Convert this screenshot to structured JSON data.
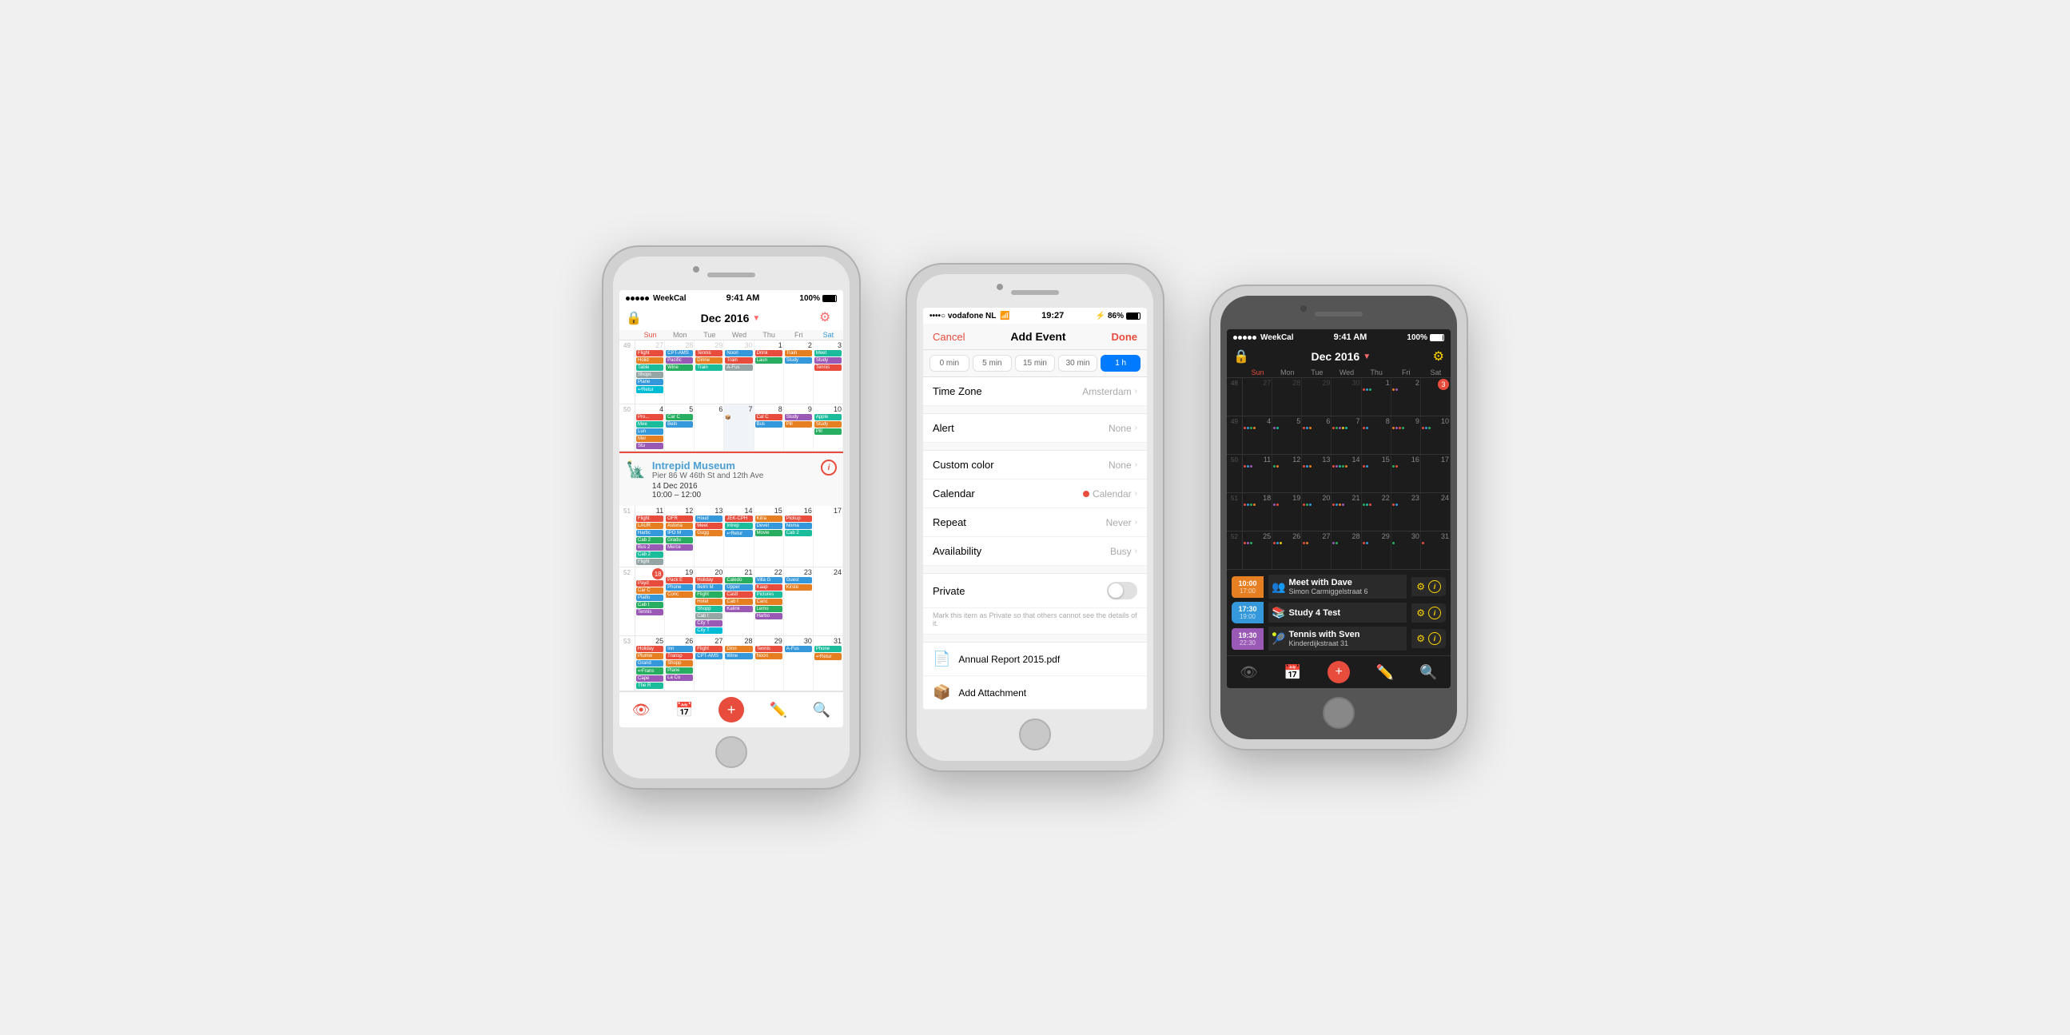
{
  "phone1": {
    "statusBar": {
      "carrier": "WeekCal",
      "time": "9:41 AM",
      "battery": "100%"
    },
    "header": {
      "title": "Dec 2016",
      "gearIcon": "⚙"
    },
    "dayLabels": [
      "",
      "Sun",
      "Mon",
      "Tue",
      "Wed",
      "Thu",
      "Fri",
      "Sat"
    ],
    "weeks": [
      {
        "weekNum": "49",
        "days": [
          {
            "date": "27",
            "prev": true
          },
          {
            "date": "28",
            "prev": true
          },
          {
            "date": "29",
            "prev": true
          },
          {
            "date": "30",
            "prev": true
          },
          {
            "date": "1"
          },
          {
            "date": "2"
          },
          {
            "date": "3"
          }
        ]
      },
      {
        "weekNum": "50",
        "days": [
          {
            "date": "4"
          },
          {
            "date": "5"
          },
          {
            "date": "6"
          },
          {
            "date": "7"
          },
          {
            "date": "8"
          },
          {
            "date": "9"
          },
          {
            "date": "10"
          }
        ]
      },
      {
        "weekNum": "51",
        "days": [
          {
            "date": "11"
          },
          {
            "date": "12"
          },
          {
            "date": "13"
          },
          {
            "date": "14"
          },
          {
            "date": "15"
          },
          {
            "date": "16"
          },
          {
            "date": "17"
          }
        ]
      },
      {
        "weekNum": "52",
        "days": [
          {
            "date": "18"
          },
          {
            "date": "19"
          },
          {
            "date": "20"
          },
          {
            "date": "21"
          },
          {
            "date": "22"
          },
          {
            "date": "23"
          },
          {
            "date": "24"
          }
        ]
      },
      {
        "weekNum": "53",
        "days": [
          {
            "date": "25"
          },
          {
            "date": "26"
          },
          {
            "date": "27"
          },
          {
            "date": "28"
          },
          {
            "date": "29"
          },
          {
            "date": "30"
          },
          {
            "date": "31"
          }
        ]
      }
    ],
    "eventCard": {
      "icon": "🗽",
      "name": "Intrepid Museum",
      "location": "Pier 86 W 46th St and 12th Ave",
      "date": "14 Dec 2016",
      "timeRange": "10:00 – 12:00"
    },
    "toolbar": {
      "items": [
        "👁",
        "📅",
        "➕",
        "✏",
        "🔍"
      ]
    }
  },
  "phone2": {
    "statusBar": {
      "carrier": "••••○ vodafone NL",
      "wifi": "wifi",
      "time": "19:27",
      "bluetooth": "B",
      "battery": "86%"
    },
    "header": {
      "cancelLabel": "Cancel",
      "title": "Add Event",
      "doneLabel": "Done"
    },
    "alertButtons": [
      {
        "label": "0 min",
        "active": false
      },
      {
        "label": "5 min",
        "active": false
      },
      {
        "label": "15 min",
        "active": false
      },
      {
        "label": "30 min",
        "active": false
      },
      {
        "label": "1 h",
        "active": true
      }
    ],
    "formRows": [
      {
        "label": "Time Zone",
        "value": "Amsterdam",
        "hasChevron": true
      },
      {
        "label": "Alert",
        "value": "None",
        "hasChevron": true
      },
      {
        "label": "Custom color",
        "value": "None",
        "hasChevron": true
      },
      {
        "label": "Calendar",
        "value": "Calendar",
        "hasDot": true,
        "hasChevron": true
      },
      {
        "label": "Repeat",
        "value": "Never",
        "hasChevron": true
      },
      {
        "label": "Availability",
        "value": "Busy",
        "hasChevron": true
      }
    ],
    "privateRow": {
      "label": "Private",
      "note": "Mark this item as Private so that others cannot see the details of it."
    },
    "attachments": [
      {
        "icon": "📄",
        "label": "Annual Report 2015.pdf",
        "isDropbox": false
      },
      {
        "icon": "📦",
        "label": "Add Attachment",
        "isDropbox": true
      }
    ]
  },
  "phone3": {
    "statusBar": {
      "carrier": "WeekCal",
      "time": "9:41 AM",
      "battery": "100%"
    },
    "header": {
      "title": "Dec 2016",
      "gearIcon": "⚙"
    },
    "dayLabels": [
      "",
      "Sun",
      "Tue",
      "Wed",
      "Thu",
      "Fri",
      "Sat"
    ],
    "weeks": [
      {
        "weekNum": "48",
        "days": [
          "27",
          "28",
          "29",
          "30",
          "1",
          "2",
          "3"
        ]
      },
      {
        "weekNum": "49",
        "days": [
          "4",
          "5",
          "6",
          "7",
          "8",
          "9",
          "10"
        ]
      },
      {
        "weekNum": "50",
        "days": [
          "11",
          "12",
          "13",
          "14",
          "15",
          "16",
          "17"
        ]
      },
      {
        "weekNum": "51",
        "days": [
          "18",
          "19",
          "20",
          "21",
          "22",
          "23",
          "24"
        ]
      },
      {
        "weekNum": "52",
        "days": [
          "25",
          "26",
          "27",
          "28",
          "29",
          "30",
          "31"
        ]
      }
    ],
    "events": [
      {
        "startTime": "10:00",
        "endTime": "17:00",
        "color": "#e67e22",
        "icon": "👥",
        "title": "Meet with Dave",
        "subtitle": "Simon Carmiggelstraat 6"
      },
      {
        "startTime": "17:30",
        "endTime": "19:00",
        "color": "#3498db",
        "icon": "📚",
        "title": "Study 4 Test",
        "subtitle": ""
      },
      {
        "startTime": "19:30",
        "endTime": "22:30",
        "color": "#9b59b6",
        "icon": "🎾",
        "title": "Tennis with Sven",
        "subtitle": "Kinderdijkstraat 31"
      }
    ],
    "toolbar": {
      "items": [
        "👁",
        "📅",
        "➕",
        "✏",
        "🔍"
      ]
    }
  }
}
